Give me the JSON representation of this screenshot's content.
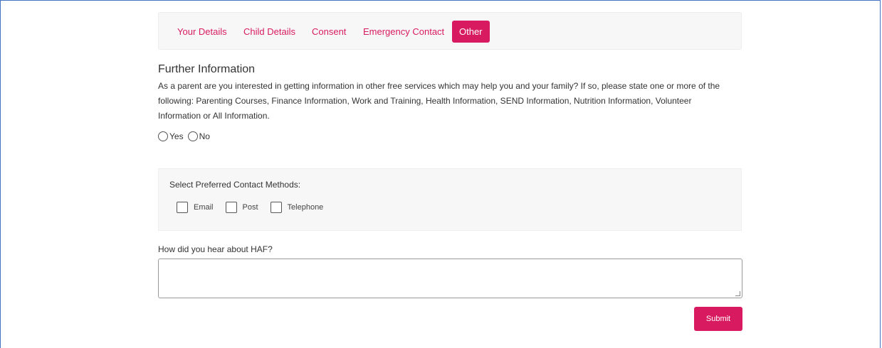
{
  "tabs": [
    {
      "label": "Your Details"
    },
    {
      "label": "Child Details"
    },
    {
      "label": "Consent"
    },
    {
      "label": "Emergency Contact"
    },
    {
      "label": "Other"
    }
  ],
  "active_tab": "Other",
  "further_info": {
    "title": "Further Information",
    "description": "As a parent are you interested in getting information in other free services which may help you and your family? If so, please state one or more of the following: Parenting Courses, Finance Information, Work and Training, Health Information, SEND Information, Nutrition Information, Volunteer Information or All Information.",
    "options": [
      {
        "label": "Yes"
      },
      {
        "label": "No"
      }
    ]
  },
  "contact": {
    "label": "Select Preferred Contact Methods:",
    "options": [
      {
        "label": "Email"
      },
      {
        "label": "Post"
      },
      {
        "label": "Telephone"
      }
    ]
  },
  "hear": {
    "label": "How did you hear about HAF?",
    "value": ""
  },
  "submit_label": "Submit",
  "colors": {
    "accent": "#d81b60",
    "frame": "#4472c4"
  }
}
